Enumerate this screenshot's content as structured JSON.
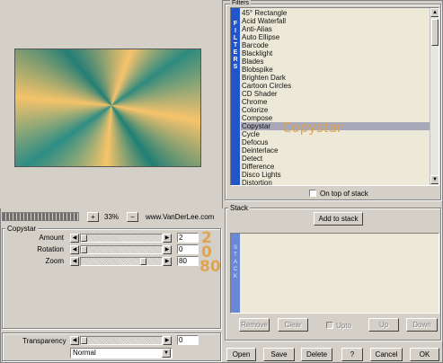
{
  "zoom": {
    "value": "33%",
    "plus": "+",
    "minus": "−",
    "brand": "www.VanDerLee.com"
  },
  "copystar": {
    "group_title": "Copystar",
    "params": [
      {
        "label": "Amount",
        "value": "2",
        "big": "2",
        "level": 0.0
      },
      {
        "label": "Rotation",
        "value": "0",
        "big": "0",
        "level": 0.0
      },
      {
        "label": "Zoom",
        "value": "80",
        "big": "80",
        "level": 0.8
      }
    ]
  },
  "transparency": {
    "label": "Transparency",
    "value": "0",
    "level": 0.0
  },
  "blend_mode": {
    "selected": "Normal"
  },
  "filters": {
    "group_title": "Filters",
    "band_letters": [
      "F",
      "I",
      "L",
      "T",
      "E",
      "R",
      "S"
    ],
    "items": [
      "45° Rectangle",
      "Acid Waterfall",
      "Anti-Alias",
      "Auto Ellipse",
      "Barcode",
      "Blacklight",
      "Blades",
      "Blobspike",
      "Brighten Dark",
      "Cartoon Circles",
      "CD Shader",
      "Chrome",
      "Colorize",
      "Compose",
      "Copystar",
      "Cycle",
      "Defocus",
      "Deinterlace",
      "Detect",
      "Difference",
      "Disco Lights",
      "Distortion"
    ],
    "selected": "Copystar",
    "selected_overlay": "Copystar",
    "on_top_label": "On top of stack"
  },
  "stack": {
    "group_title": "Stack",
    "add_button": "Add to stack",
    "band_letters": [
      "S",
      "T",
      "A",
      "C",
      "K"
    ],
    "remove": "Remove",
    "clear": "Clear",
    "upto": "Upto",
    "up": "Up",
    "down": "Down"
  },
  "footer": {
    "open": "Open",
    "save": "Save",
    "delete": "Delete",
    "help": "?",
    "cancel": "Cancel",
    "ok": "OK"
  }
}
